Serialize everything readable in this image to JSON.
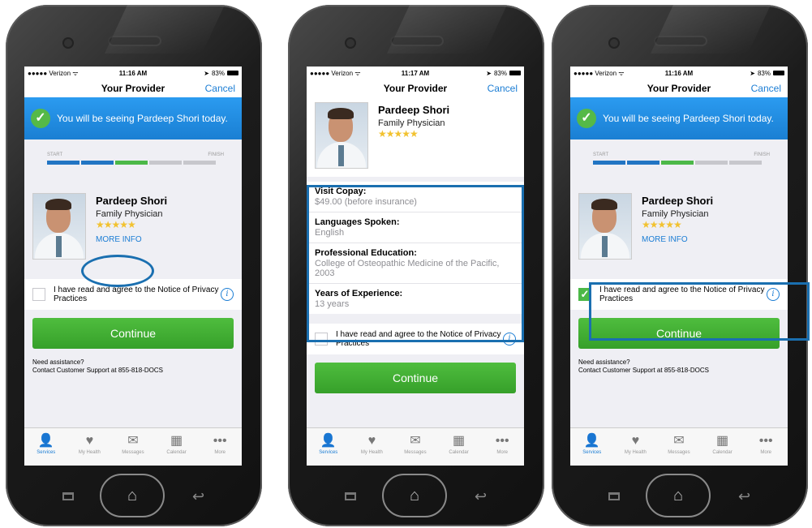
{
  "status_bar": [
    {
      "carrier": "●●●●● Verizon ᯤ",
      "time": "11:16 AM",
      "battery": "83%"
    },
    {
      "carrier": "●●●●● Verizon ᯤ",
      "time": "11:17 AM",
      "battery": "83%"
    },
    {
      "carrier": "●●●●● Verizon ᯤ",
      "time": "11:16 AM",
      "battery": "83%"
    }
  ],
  "nav": {
    "title": "Your Provider",
    "cancel": "Cancel"
  },
  "banner": {
    "message": "You will be seeing Pardeep Shori today."
  },
  "progress": {
    "start": "START",
    "finish": "FINISH",
    "completed_steps": 3,
    "total_steps": 5
  },
  "provider": {
    "name": "Pardeep Shori",
    "specialty": "Family Physician",
    "stars": "★★★★★",
    "more_info": "MORE INFO"
  },
  "details": [
    {
      "label": "Visit Copay:",
      "value": "$49.00 (before insurance)"
    },
    {
      "label": "Languages Spoken:",
      "value": "English"
    },
    {
      "label": "Professional Education:",
      "value": "College of Osteopathic Medicine of the Pacific, 2003"
    },
    {
      "label": "Years of Experience:",
      "value": "13 years"
    }
  ],
  "agreement": {
    "text": "I have read and agree to the Notice of Privacy Practices",
    "info": "i",
    "checkmark": "✓"
  },
  "continue_label": "Continue",
  "assist": {
    "line1": "Need assistance?",
    "line2": "Contact Customer Support at 855-818-DOCS"
  },
  "tabs": [
    {
      "label": "Services",
      "icon": "person-icon",
      "glyph": "👤"
    },
    {
      "label": "My Health",
      "icon": "heart-icon",
      "glyph": "♥"
    },
    {
      "label": "Messages",
      "icon": "envelope-icon",
      "glyph": "✉"
    },
    {
      "label": "Calendar",
      "icon": "calendar-icon",
      "glyph": "▦"
    },
    {
      "label": "More",
      "icon": "more-icon",
      "glyph": "•••"
    }
  ],
  "colors": {
    "accent": "#1b7dd4",
    "green": "#4cb848",
    "annotation": "#1a6fb0"
  }
}
